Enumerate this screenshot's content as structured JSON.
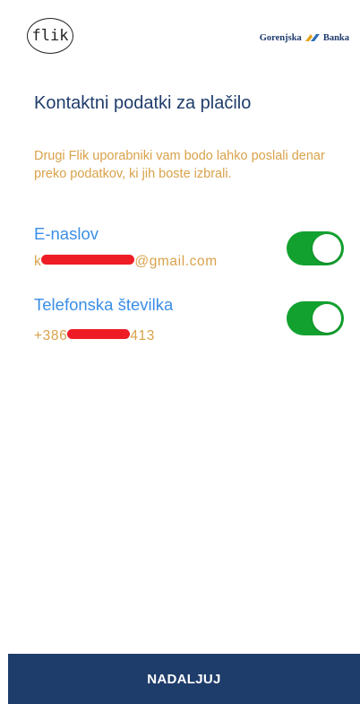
{
  "header": {
    "logo_text": "flik",
    "bank_name_1": "Gorenjska",
    "bank_name_2": "Banka"
  },
  "title": "Kontaktni podatki za plačilo",
  "intro": "Drugi Flik uporabniki vam bodo lahko poslali denar preko podatkov, ki jih boste izbrali.",
  "contacts": [
    {
      "label": "E-naslov",
      "value_prefix": "k",
      "value_suffix": "@gmail.com",
      "enabled": true
    },
    {
      "label": "Telefonska številka",
      "value_prefix": "+386",
      "value_suffix": "413",
      "enabled": true
    }
  ],
  "colors": {
    "title": "#1f3d6b",
    "accent_text": "#d9a24a",
    "label": "#3a8ee6",
    "toggle_on": "#12a12f",
    "button_bg": "#1f3d6b",
    "redaction": "#ee1c25"
  },
  "footer": {
    "continue_label": "NADALJUJ"
  }
}
